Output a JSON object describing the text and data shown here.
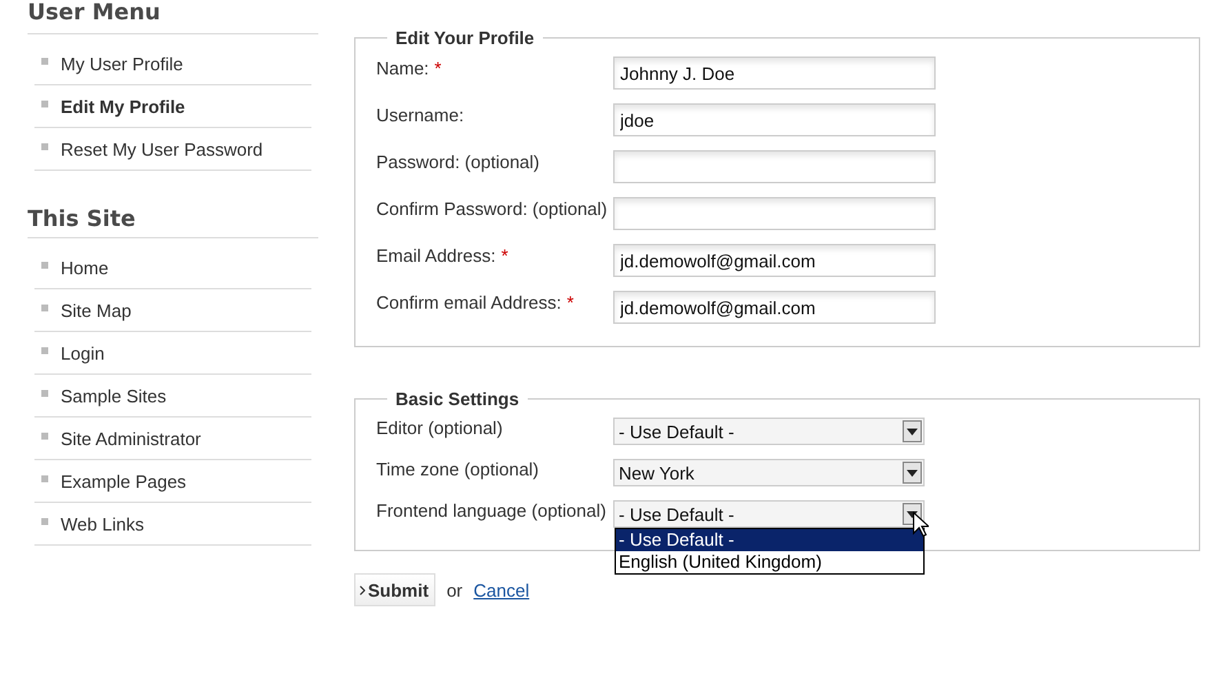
{
  "sidebar": [
    {
      "heading": "User Menu",
      "items": [
        {
          "label": "My User Profile",
          "selected": false
        },
        {
          "label": "Edit My Profile",
          "selected": true
        },
        {
          "label": "Reset My User Password",
          "selected": false
        }
      ]
    },
    {
      "heading": "This Site",
      "items": [
        {
          "label": "Home",
          "selected": false
        },
        {
          "label": "Site Map",
          "selected": false
        },
        {
          "label": "Login",
          "selected": false
        },
        {
          "label": "Sample Sites",
          "selected": false
        },
        {
          "label": "Site Administrator",
          "selected": false
        },
        {
          "label": "Example Pages",
          "selected": false
        },
        {
          "label": "Web Links",
          "selected": false
        }
      ]
    }
  ],
  "profile": {
    "legend": "Edit Your Profile",
    "fields": [
      {
        "label": "Name:",
        "marker": "*",
        "value": "Johnny J. Doe"
      },
      {
        "label": "Username:",
        "value": "jdoe"
      },
      {
        "label": "Password: (optional)"
      },
      {
        "label": "Confirm Password: (optional)"
      },
      {
        "label": "Email Address:",
        "marker": "*",
        "value": "jd.demowolf@gmail.com"
      },
      {
        "label": "Confirm email Address:",
        "marker": "*",
        "value": "jd.demowolf@gmail.com"
      }
    ]
  },
  "settings": {
    "legend": "Basic Settings",
    "selects": [
      {
        "label": "Editor (optional)",
        "value": "- Use Default -",
        "expanded": false
      },
      {
        "label": "Time zone (optional)",
        "value": "New York",
        "expanded": false
      },
      {
        "label": "Frontend language (optional)",
        "value": "- Use Default -",
        "expanded": true,
        "options": [
          {
            "label": "- Use Default -",
            "selected": true
          },
          {
            "label": "English (United Kingdom)",
            "selected": false
          }
        ]
      }
    ]
  },
  "actions": {
    "submit": "Submit",
    "or": "or",
    "cancel": "Cancel"
  }
}
